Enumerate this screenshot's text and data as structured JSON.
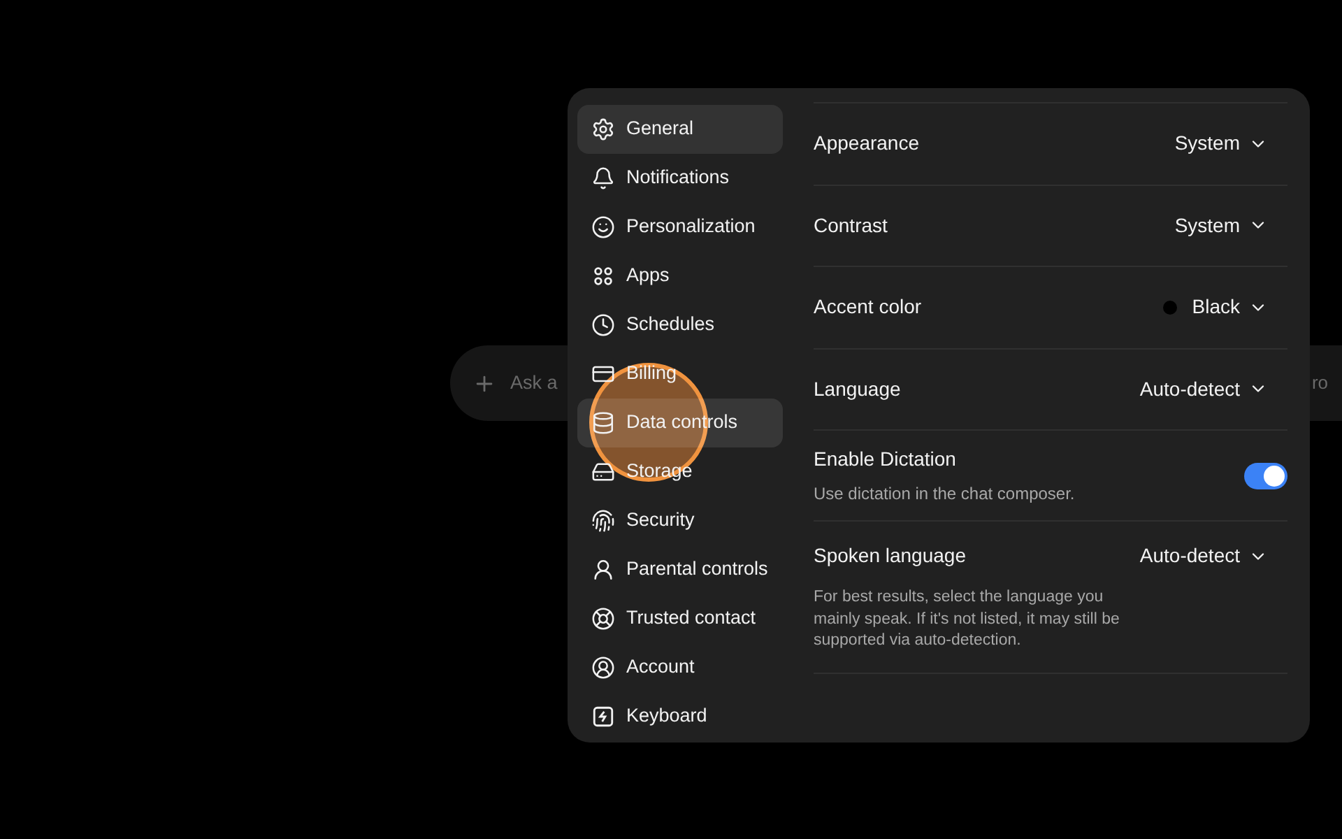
{
  "composer": {
    "placeholder": "Ask a",
    "trailing": "ro"
  },
  "sidebar": {
    "items": [
      {
        "label": "General",
        "selected": true,
        "hovered": false
      },
      {
        "label": "Notifications",
        "selected": false,
        "hovered": false
      },
      {
        "label": "Personalization",
        "selected": false,
        "hovered": false
      },
      {
        "label": "Apps",
        "selected": false,
        "hovered": false
      },
      {
        "label": "Schedules",
        "selected": false,
        "hovered": false
      },
      {
        "label": "Billing",
        "selected": false,
        "hovered": false
      },
      {
        "label": "Data controls",
        "selected": false,
        "hovered": true
      },
      {
        "label": "Storage",
        "selected": false,
        "hovered": false
      },
      {
        "label": "Security",
        "selected": false,
        "hovered": false
      },
      {
        "label": "Parental controls",
        "selected": false,
        "hovered": false
      },
      {
        "label": "Trusted contact",
        "selected": false,
        "hovered": false
      },
      {
        "label": "Account",
        "selected": false,
        "hovered": false
      },
      {
        "label": "Keyboard",
        "selected": false,
        "hovered": false
      }
    ]
  },
  "settings": [
    {
      "kind": "select",
      "label": "Appearance",
      "value": "System"
    },
    {
      "kind": "select",
      "label": "Contrast",
      "value": "System"
    },
    {
      "kind": "select",
      "label": "Accent color",
      "value": "Black",
      "color": "#000000"
    },
    {
      "kind": "select",
      "label": "Language",
      "value": "Auto-detect"
    },
    {
      "kind": "toggle",
      "label": "Enable Dictation",
      "description": "Use dictation in the chat composer.",
      "on": true
    },
    {
      "kind": "select",
      "label": "Spoken language",
      "value": "Auto-detect",
      "description": "For best results, select the language you mainly speak. If it's not listed, it may still be supported via auto-detection."
    }
  ]
}
